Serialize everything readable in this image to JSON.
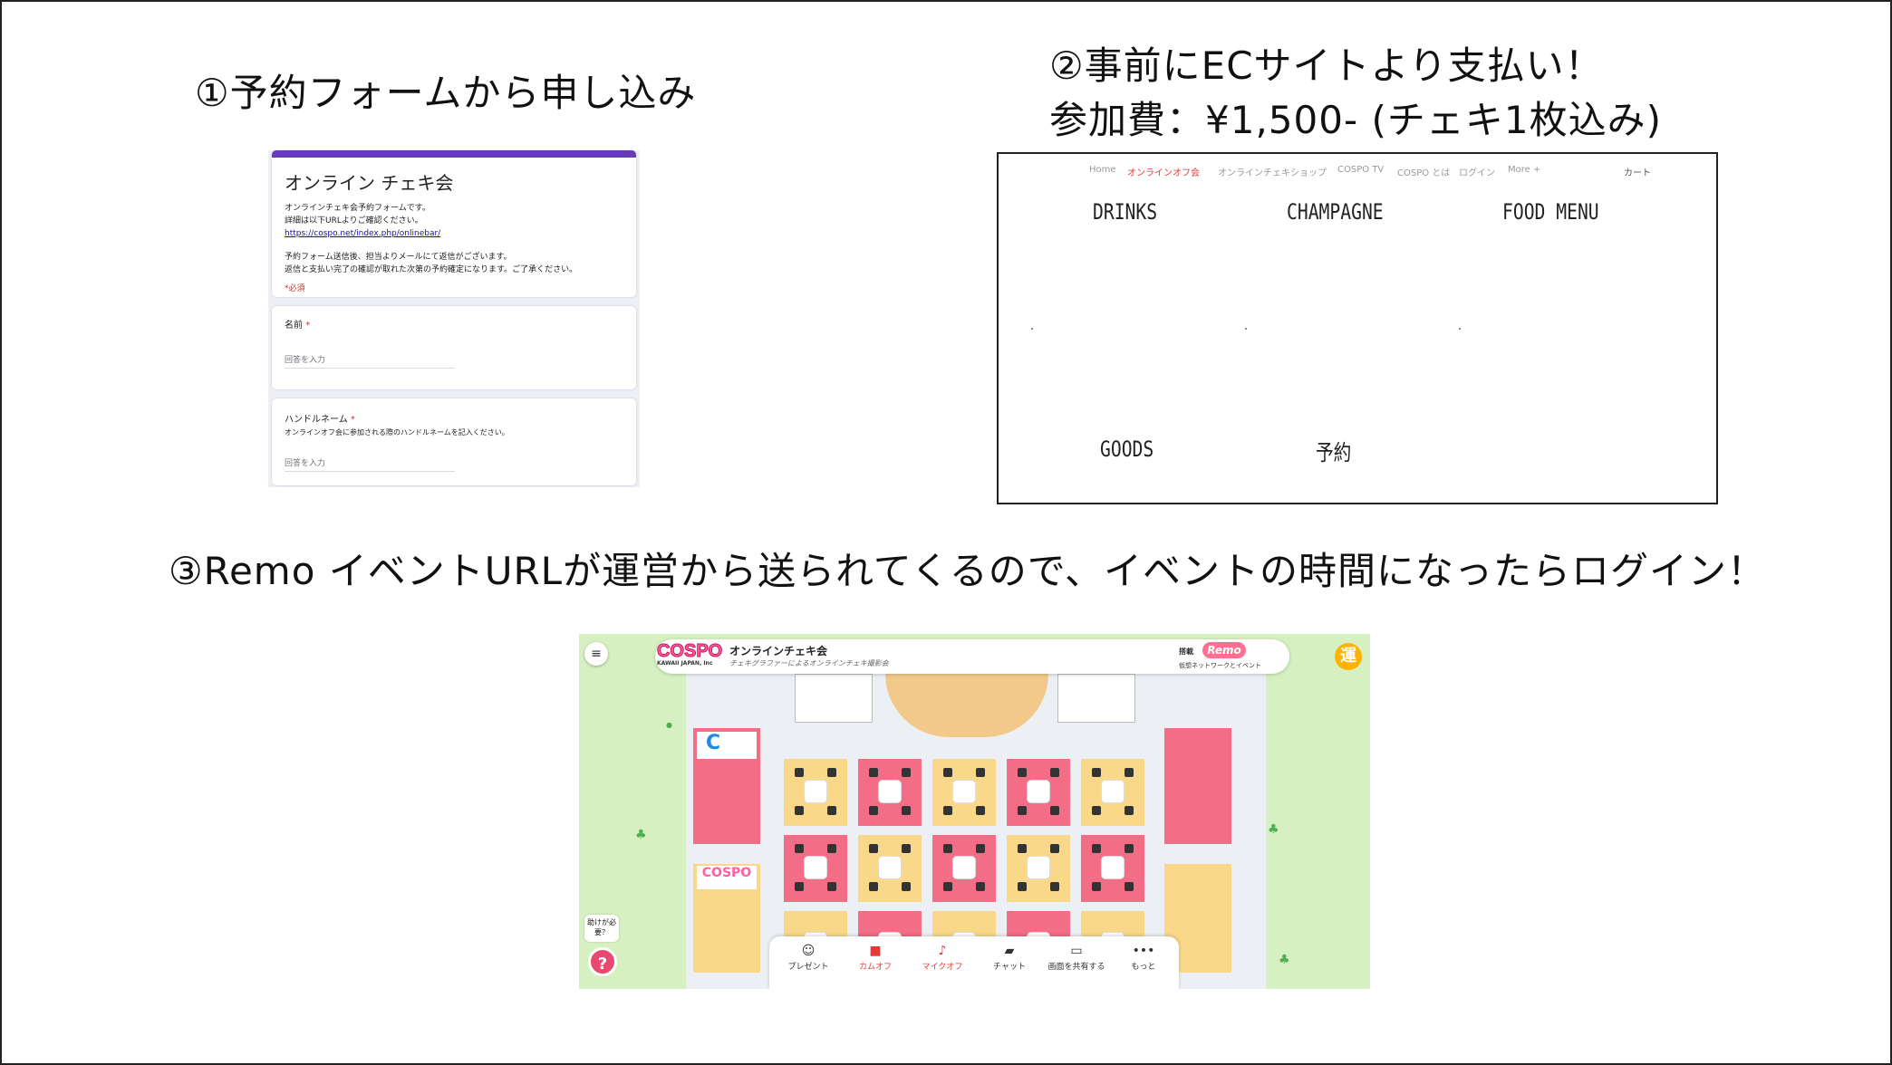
{
  "steps": {
    "step1": "①予約フォームから申し込み",
    "step2_line1": "②事前にECサイトより支払い！",
    "step2_line2": "参加費：¥1,500- (チェキ1枚込み)",
    "step3": "③Remo イベントURLが運営から送られてくるので、イベントの時間になったらログイン！"
  },
  "form": {
    "title": "オンライン チェキ会",
    "desc_line1": "オンラインチェキ会予約フォームです。",
    "desc_line2": "詳細は以下URLよりご確認ください。",
    "link": "https://cospo.net/index.php/onlinebar/",
    "desc_line3": "予約フォーム送信後、担当よりメールにて返信がございます。",
    "desc_line4": "返信と支払い完了の確認が取れた次第の予約確定になります。ご了承ください。",
    "required_note": "*必須",
    "q1_label": "名前",
    "q1_star": "*",
    "q1_placeholder": "回答を入力",
    "q2_label": "ハンドルネーム",
    "q2_star": "*",
    "q2_help": "オンラインオフ会に参加される際のハンドルネームを記入ください。",
    "q2_placeholder": "回答を入力",
    "accent_color": "#673ab7"
  },
  "ec_site": {
    "nav": [
      "Home",
      "オンラインオフ会",
      "オンラインチェキショップ",
      "COSPO TV",
      "COSPO とは",
      "ログイン",
      "More +"
    ],
    "nav_active": "オンラインオフ会",
    "cart": "カート",
    "menu": [
      "DRINKS",
      "CHAMPAGNE",
      "FOOD MENU",
      "GOODS",
      "予約"
    ]
  },
  "remo": {
    "logo_text": "COSPO",
    "logo_sub": "KAWAII JAPAN, Inc",
    "event_title": "オンラインチェキ会",
    "event_subtitle": "チェキグラファーによるオンラインチェキ撮影会",
    "sponsor_label": "搭載",
    "remo_logo": "Remo",
    "remo_tagline": "仮想ネットワークとイベント",
    "admin_badge": "運",
    "help_bubble_line1": "助けが必",
    "help_bubble_line2": "要？",
    "help_button": "?",
    "controls": [
      {
        "label": "プレゼント",
        "icon": "presenter-icon",
        "off": false
      },
      {
        "label": "カムオフ",
        "icon": "camera-off-icon",
        "off": true
      },
      {
        "label": "マイクオフ",
        "icon": "mic-off-icon",
        "off": true
      },
      {
        "label": "チャット",
        "icon": "chat-icon",
        "off": false
      },
      {
        "label": "画面を共有する",
        "icon": "screen-share-icon",
        "off": false
      },
      {
        "label": "もっと",
        "icon": "more-icon",
        "off": false
      }
    ]
  }
}
